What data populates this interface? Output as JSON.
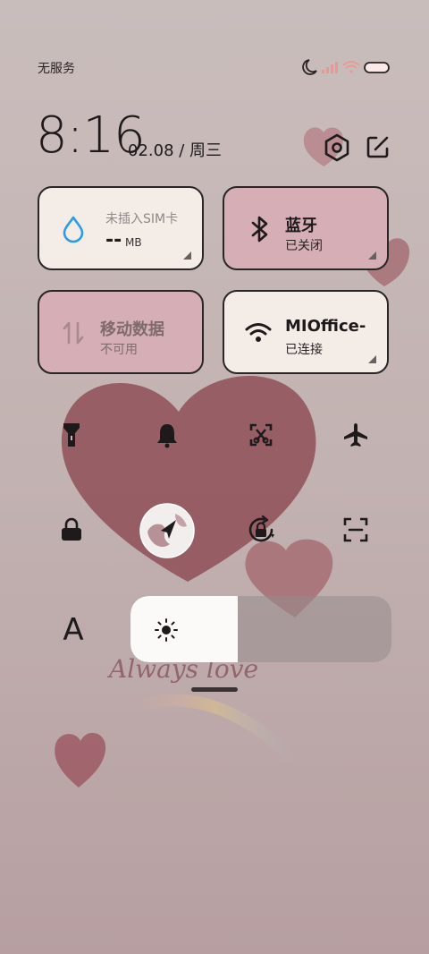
{
  "status_bar": {
    "carrier": "无服务",
    "icons": [
      "moon-icon",
      "signal-icon",
      "wifi-icon",
      "battery-icon"
    ]
  },
  "header": {
    "time": "8:16",
    "date": "02.08 / 周三",
    "icons": [
      "settings-icon",
      "edit-icon"
    ]
  },
  "tiles": {
    "data_usage": {
      "title": "--",
      "title_unit": "MB",
      "subtitle": "未插入SIM卡",
      "icon": "droplet-icon"
    },
    "bluetooth": {
      "title": "蓝牙",
      "subtitle": "已关闭",
      "icon": "bluetooth-icon"
    },
    "mobile_data": {
      "title": "移动数据",
      "subtitle": "不可用",
      "icon": "arrows-updown-icon"
    },
    "wifi": {
      "title": "MIOffice-",
      "subtitle": "已连接",
      "icon": "wifi-icon"
    }
  },
  "toggles_row1": [
    "flashlight-icon",
    "bell-icon",
    "screenshot-icon",
    "airplane-icon"
  ],
  "toggles_row2": [
    "lock-icon",
    "location-icon",
    "rotation-lock-icon",
    "scan-icon"
  ],
  "brightness": {
    "level": 0.41
  },
  "font_button": "A",
  "colors": {
    "tile_light": "#f4ede7",
    "tile_pink": "#d6aeb5",
    "accent_blue": "#2f9be8"
  }
}
